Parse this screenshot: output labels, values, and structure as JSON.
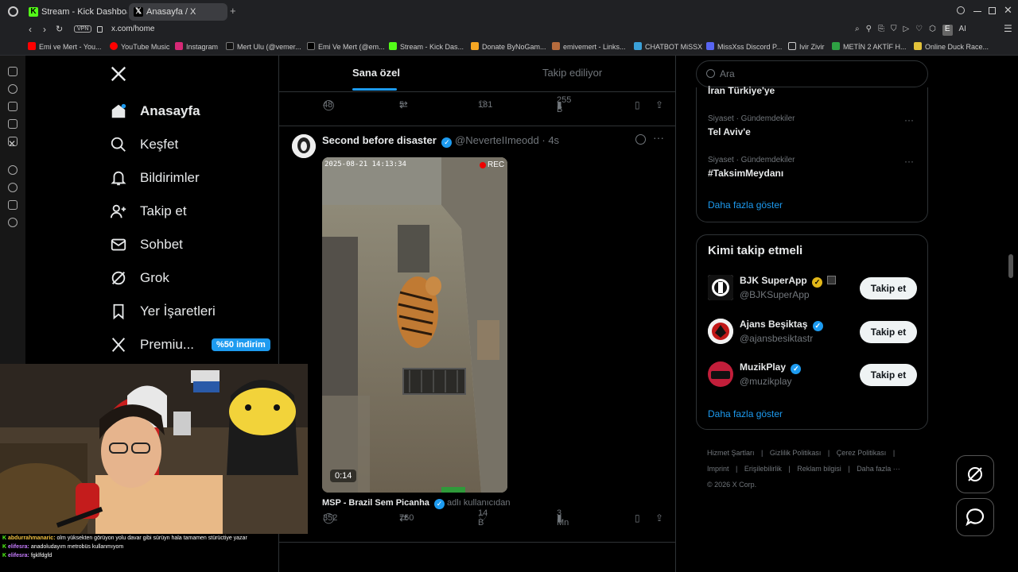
{
  "browser": {
    "tabs": [
      {
        "label": "Stream - Kick Dashboard",
        "active": false
      },
      {
        "label": "Anasayfa / X",
        "active": true
      }
    ],
    "address": "x.com/home",
    "vpn_label": "VPN",
    "profile_initial": "E",
    "ai_label": "AI",
    "bookmarks": [
      "Emi ve Mert - You...",
      "YouTube Music",
      "Instagram",
      "Mert Ulu (@vemer...",
      "Emi Ve Mert (@em...",
      "Stream - Kick Das...",
      "Donate ByNoGam...",
      "emivemert - Links...",
      "CHATBOT MiSSX",
      "MissXss Discord P...",
      "Ivir Zivir",
      "METİN 2 AKTİF H...",
      "Online Duck Race..."
    ]
  },
  "nav": {
    "items": [
      {
        "label": "Anasayfa",
        "icon": "home-icon"
      },
      {
        "label": "Keşfet",
        "icon": "search-icon"
      },
      {
        "label": "Bildirimler",
        "icon": "bell-icon"
      },
      {
        "label": "Takip et",
        "icon": "person-plus-icon"
      },
      {
        "label": "Sohbet",
        "icon": "mail-icon"
      },
      {
        "label": "Grok",
        "icon": "grok-icon"
      },
      {
        "label": "Yer İşaretleri",
        "icon": "bookmark-icon"
      },
      {
        "label": "Premiu...",
        "icon": "x-logo-icon"
      }
    ],
    "premium_badge": "%50 indirim"
  },
  "feed": {
    "tabs": [
      "Sana özel",
      "Takip ediliyor"
    ],
    "prev_post_stats": {
      "replies": "48",
      "reposts": "5",
      "likes": "181",
      "views": "255 B"
    },
    "post": {
      "author": "Second before disaster",
      "handle": "@NeverteIImeodd",
      "time": "4s",
      "video_timestamp": "2025-08-21 14:13:34",
      "rec_label": "REC",
      "duration": "0:14",
      "source_account": "MSP - Brazil Sem Picanha",
      "source_suffix": "adlı kullanıcıdan",
      "stats": {
        "replies": "352",
        "reposts": "760",
        "likes": "14 B",
        "views": "3 Mn"
      }
    }
  },
  "right": {
    "search_placeholder": "Ara",
    "trends_cut": "İran Türkiye'ye",
    "trends": [
      {
        "context": "Siyaset · Gündemdekiler",
        "title": "Tel Aviv'e"
      },
      {
        "context": "Siyaset · Gündemdekiler",
        "title": "#TaksimMeydanı"
      }
    ],
    "show_more": "Daha fazla göster",
    "who_to_follow_title": "Kimi takip etmeli",
    "suggestions": [
      {
        "name": "BJK SuperApp",
        "handle": "@BJKSuperApp",
        "badge": "gold",
        "button": "Takip et"
      },
      {
        "name": "Ajans Beşiktaş",
        "handle": "@ajansbesiktastr",
        "badge": "blue",
        "button": "Takip et"
      },
      {
        "name": "MuzikPlay",
        "handle": "@muzikplay",
        "badge": "blue",
        "button": "Takip et"
      }
    ],
    "show_more_2": "Daha fazla göster",
    "footer_links": [
      "Hizmet Şartları",
      "Gizlilik Politikası",
      "Çerez Politikası",
      "Imprint",
      "Erişilebilirlik",
      "Reklam bilgisi",
      "Daha fazla ···"
    ],
    "copyright": "© 2026 X Corp."
  },
  "chat": [
    {
      "user": "abdurrahmanaric:",
      "text": "olm yüksekten görüyon yolu davar gibi sürüyn hala tamamen stürüctiye yazar"
    },
    {
      "user": "elifesra:",
      "text": "anadoludayım metrobüs kullanmıyom"
    },
    {
      "user": "elifesra:",
      "text": "fgklfdgfd"
    }
  ],
  "colors": {
    "accent": "#1d9bf0",
    "background": "#000000",
    "border": "#2f3336",
    "muted": "#71767b"
  }
}
